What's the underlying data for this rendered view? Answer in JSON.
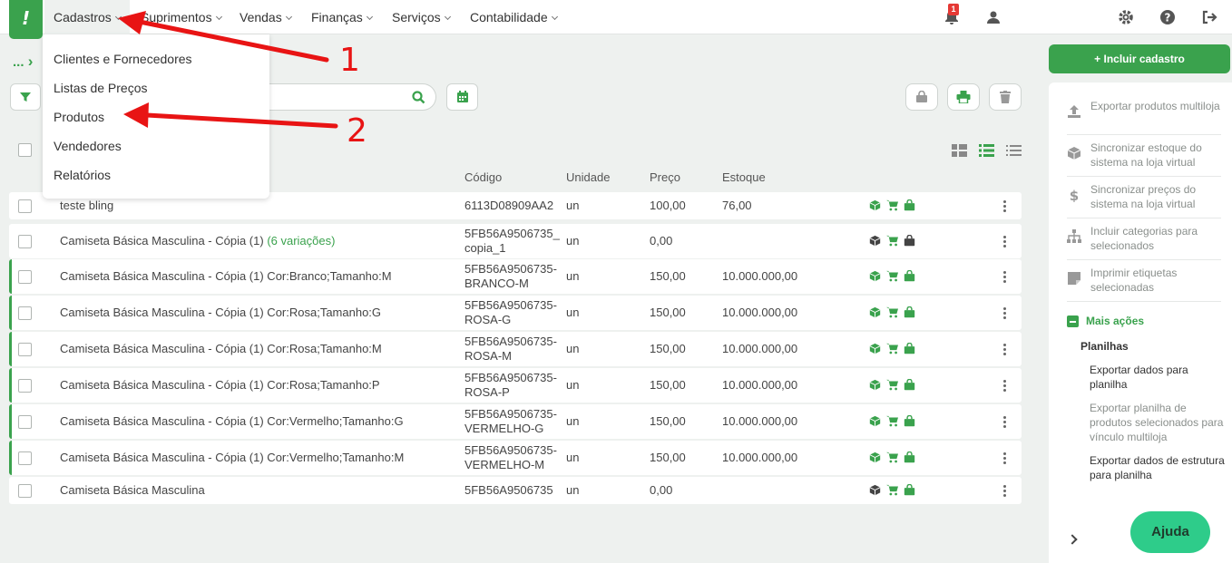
{
  "nav": {
    "logo": "!",
    "items": [
      "Cadastros",
      "Suprimentos",
      "Vendas",
      "Finanças",
      "Serviços",
      "Contabilidade"
    ],
    "notifications_count": "1"
  },
  "dropdown": {
    "items": [
      "Clientes e Fornecedores",
      "Listas de Preços",
      "Produtos",
      "Vendedores",
      "Relatórios"
    ]
  },
  "breadcrumb": {
    "ellipsis": "..."
  },
  "table": {
    "headers": {
      "code": "Código",
      "unit": "Unidade",
      "price": "Preço",
      "stock": "Estoque"
    },
    "rows": [
      {
        "name": "teste bling",
        "variations": "",
        "code": "6113D08909AA2",
        "unit": "un",
        "price": "100,00",
        "stock": "76,00"
      },
      {
        "name": "Camiseta Básica Masculina - Cópia (1)",
        "variations": "(6 variações)",
        "code": "5FB56A9506735_\ncopia_1",
        "unit": "un",
        "price": "0,00",
        "stock": ""
      },
      {
        "name": "Camiseta Básica Masculina - Cópia (1) Cor:Branco;Tamanho:M",
        "variations": "",
        "code": "5FB56A9506735-\nBRANCO-M",
        "unit": "un",
        "price": "150,00",
        "stock": "10.000.000,00"
      },
      {
        "name": "Camiseta Básica Masculina - Cópia (1) Cor:Rosa;Tamanho:G",
        "variations": "",
        "code": "5FB56A9506735-\nROSA-G",
        "unit": "un",
        "price": "150,00",
        "stock": "10.000.000,00"
      },
      {
        "name": "Camiseta Básica Masculina - Cópia (1) Cor:Rosa;Tamanho:M",
        "variations": "",
        "code": "5FB56A9506735-\nROSA-M",
        "unit": "un",
        "price": "150,00",
        "stock": "10.000.000,00"
      },
      {
        "name": "Camiseta Básica Masculina - Cópia (1) Cor:Rosa;Tamanho:P",
        "variations": "",
        "code": "5FB56A9506735-\nROSA-P",
        "unit": "un",
        "price": "150,00",
        "stock": "10.000.000,00"
      },
      {
        "name": "Camiseta Básica Masculina - Cópia (1) Cor:Vermelho;Tamanho:G",
        "variations": "",
        "code": "5FB56A9506735-\nVERMELHO-G",
        "unit": "un",
        "price": "150,00",
        "stock": "10.000.000,00"
      },
      {
        "name": "Camiseta Básica Masculina - Cópia (1) Cor:Vermelho;Tamanho:M",
        "variations": "",
        "code": "5FB56A9506735-\nVERMELHO-M",
        "unit": "un",
        "price": "150,00",
        "stock": "10.000.000,00"
      },
      {
        "name": "Camiseta Básica Masculina",
        "variations": "",
        "code": "5FB56A9506735",
        "unit": "un",
        "price": "0,00",
        "stock": ""
      }
    ]
  },
  "sidebar": {
    "add_label": "+ Incluir cadastro",
    "actions": [
      {
        "label": "Exportar produtos multiloja",
        "icon": "upload-icon"
      },
      {
        "label": "Sincronizar estoque do sistema na loja virtual",
        "icon": "box-icon"
      },
      {
        "label": "Sincronizar preços do sistema na loja virtual",
        "icon": "dollar-icon"
      },
      {
        "label": "Incluir categorias para selecionados",
        "icon": "sitemap-icon"
      },
      {
        "label": "Imprimir etiquetas selecionadas",
        "icon": "label-icon"
      }
    ],
    "more_actions": "Mais ações",
    "sheets_title": "Planilhas",
    "sheets": [
      "Exportar dados para planilha",
      "Exportar planilha de produtos selecionados para vínculo multiloja",
      "Exportar dados de estrutura para planilha"
    ],
    "help": "Ajuda"
  },
  "annotations": {
    "step1": "1",
    "step2": "2"
  },
  "colors": {
    "brand": "#3aa24d",
    "annotation": "#e81414",
    "help": "#2ecc8a"
  }
}
